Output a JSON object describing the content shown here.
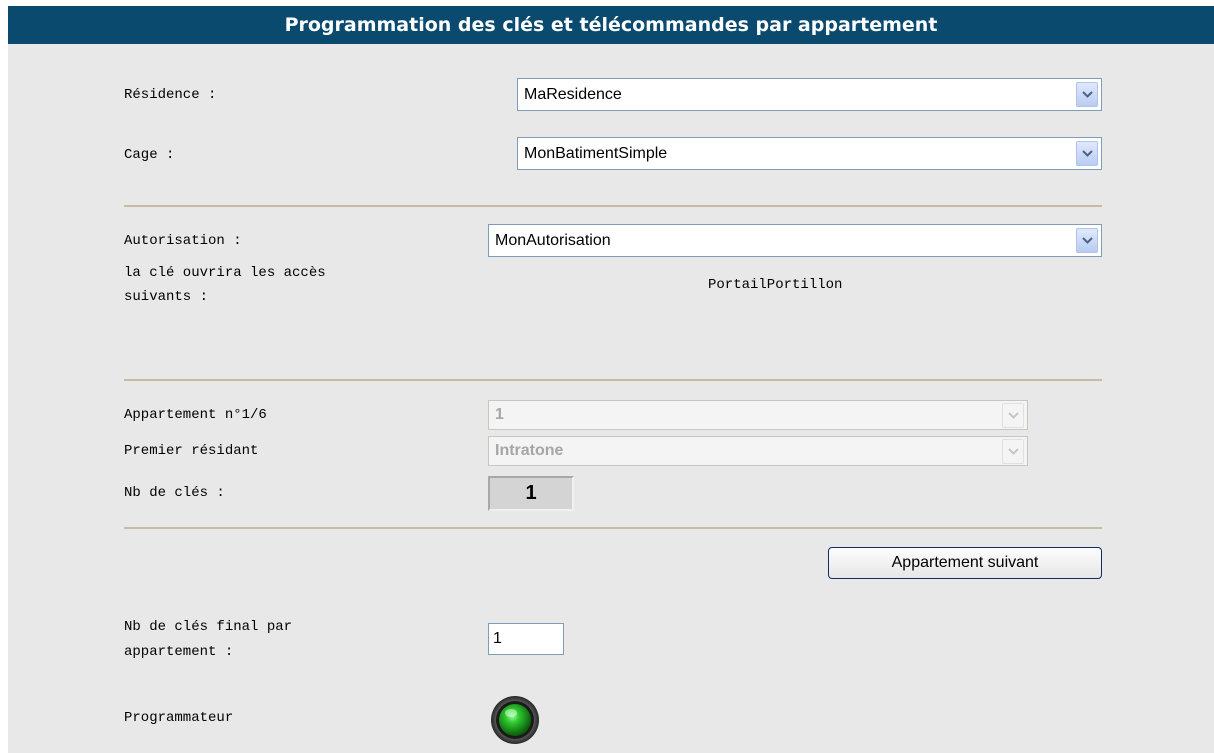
{
  "header": {
    "title": "Programmation des clés et télécommandes par appartement"
  },
  "residence": {
    "label": "Résidence :",
    "value": "MaResidence"
  },
  "cage": {
    "label": "Cage :",
    "value": "MonBatimentSimple"
  },
  "autorisation": {
    "label": "Autorisation :",
    "value": "MonAutorisation",
    "acces_label_line1": "la clé ouvrira les accès",
    "acces_label_line2": "suivants :",
    "acces_value": "PortailPortillon"
  },
  "appartement": {
    "label": "Appartement n°1/6",
    "value": "1",
    "premier_resident_label": "Premier résidant",
    "premier_resident_value": "Intratone",
    "nb_cles_label": "Nb de clés :",
    "nb_cles_value": "1"
  },
  "actions": {
    "next_button": "Appartement suivant"
  },
  "final": {
    "label_line1": "Nb de clés final par",
    "label_line2": "appartement :",
    "value": "1"
  },
  "programmateur": {
    "label": "Programmateur",
    "status_color": "#1fa31f"
  },
  "icons": {
    "dropdown": "chevron-down-icon",
    "status": "led-icon"
  }
}
